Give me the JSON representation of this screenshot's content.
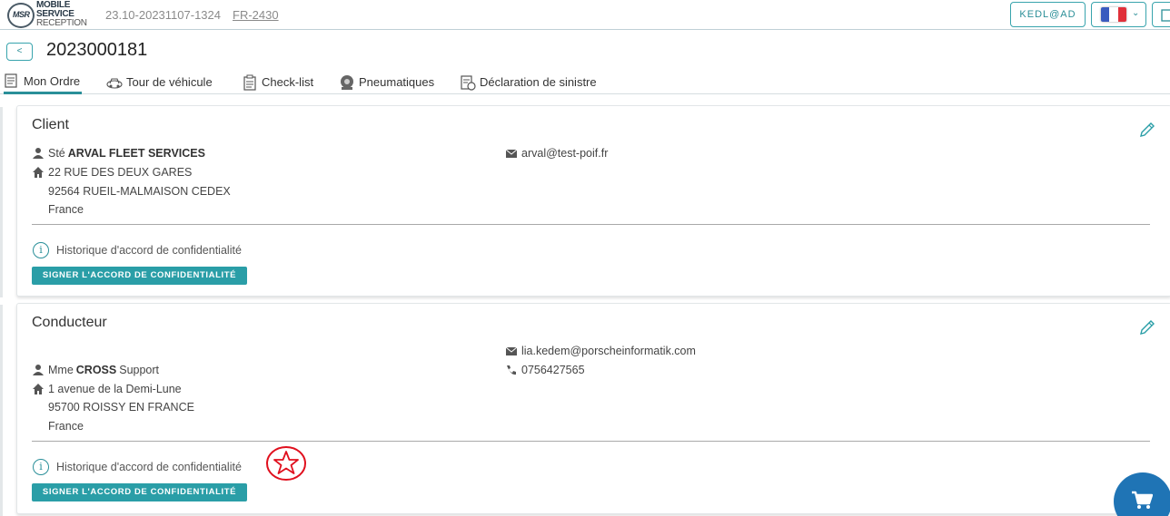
{
  "header": {
    "logo": {
      "line1": "MOBILE",
      "line2": "SERVICE",
      "line3": "RECEPTION",
      "badge": "MSR"
    },
    "version": "23.10-20231107-1324",
    "fr_link": "FR-2430",
    "user_button": "KEDL@AD",
    "language_flag_colors": [
      "#3a5bbf",
      "#ffffff",
      "#e0303a"
    ]
  },
  "order": {
    "back_label": "<",
    "number": "2023000181"
  },
  "tabs": [
    {
      "label": "Mon Ordre",
      "icon": "order-document-icon",
      "active": true
    },
    {
      "label": "Tour de véhicule",
      "icon": "vehicle-icon",
      "active": false
    },
    {
      "label": "Check-list",
      "icon": "clipboard-icon",
      "active": false
    },
    {
      "label": "Pneumatiques",
      "icon": "tire-icon",
      "active": false
    },
    {
      "label": "Déclaration de sinistre",
      "icon": "claim-document-icon",
      "active": false
    }
  ],
  "client": {
    "title": "Client",
    "prefix": "Sté",
    "name": "ARVAL FLEET SERVICES",
    "address_line1": "22 RUE DES DEUX GARES",
    "address_line2": "92564 RUEIL-MALMAISON CEDEX",
    "country": "France",
    "email": "arval@test-poif.fr",
    "history_label": "Historique d'accord de confidentialité",
    "sign_button": "SIGNER L'ACCORD DE CONFIDENTIALITÉ"
  },
  "driver": {
    "title": "Conducteur",
    "prefix": "Mme",
    "last_name": "CROSS",
    "first_name": "Support",
    "address_line1": "1 avenue de la Demi-Lune",
    "address_line2": "95700 ROISSY EN FRANCE",
    "country": "France",
    "email": "lia.kedem@porscheinformatik.com",
    "phone": "0756427565",
    "history_label": "Historique d'accord de confidentialité",
    "sign_button": "SIGNER L'ACCORD DE CONFIDENTIALITÉ"
  },
  "colors": {
    "accent": "#2a9ea7",
    "fab": "#1f74b5",
    "star_marker": "#e0101e"
  }
}
